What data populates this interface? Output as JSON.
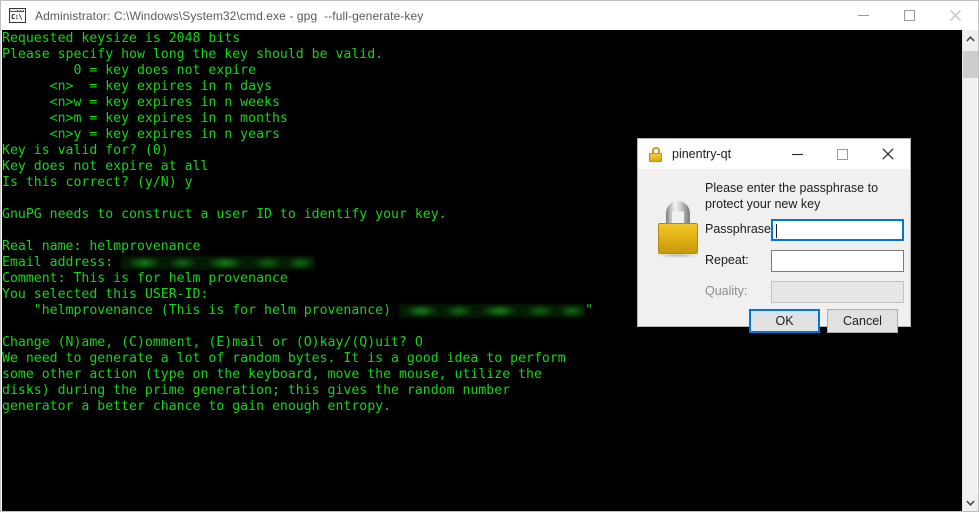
{
  "window": {
    "title": "Administrator: C:\\Windows\\System32\\cmd.exe - gpg  --full-generate-key",
    "icon": "cmd-icon",
    "prompt_glyph": "C:\\",
    "controls": {
      "minimize": "minimize-button",
      "maximize": "maximize-button",
      "close": "close-button"
    }
  },
  "console": {
    "foreground_color": "#13d713",
    "background_color": "#000000",
    "lines": [
      {
        "text": "Requested keysize is 2048 bits"
      },
      {
        "text": "Please specify how long the key should be valid."
      },
      {
        "text": "         0 = key does not expire"
      },
      {
        "text": "      <n>  = key expires in n days"
      },
      {
        "text": "      <n>w = key expires in n weeks"
      },
      {
        "text": "      <n>m = key expires in n months"
      },
      {
        "text": "      <n>y = key expires in n years"
      },
      {
        "text": "Key is valid for? (0)"
      },
      {
        "text": "Key does not expire at all"
      },
      {
        "text": "Is this correct? (y/N) y"
      },
      {
        "text": ""
      },
      {
        "text": "GnuPG needs to construct a user ID to identify your key."
      },
      {
        "text": ""
      },
      {
        "text": "Real name: helmprovenance"
      },
      {
        "text": "Email address: ",
        "redacted": "email-line"
      },
      {
        "text": "Comment: This is for helm provenance"
      },
      {
        "text": "You selected this USER-ID:"
      },
      {
        "text": "    \"helmprovenance (This is for helm provenance) ",
        "redacted": "userid-line",
        "suffix": "\""
      },
      {
        "text": ""
      },
      {
        "text": "Change (N)ame, (C)omment, (E)mail or (O)kay/(Q)uit? O"
      },
      {
        "text": "We need to generate a lot of random bytes. It is a good idea to perform"
      },
      {
        "text": "some other action (type on the keyboard, move the mouse, utilize the"
      },
      {
        "text": "disks) during the prime generation; this gives the random number"
      },
      {
        "text": "generator a better chance to gain enough entropy."
      }
    ]
  },
  "scrollbar": {
    "up_arrow": "scroll-up-arrow",
    "down_arrow": "scroll-down-arrow",
    "thumb": "scroll-thumb"
  },
  "dialog": {
    "title": "pinentry-qt",
    "icon": "padlock-icon",
    "controls": {
      "minimize": "minimize-button",
      "maximize": "maximize-button",
      "close": "close-button"
    },
    "prompt": "Please enter the passphrase to protect your new key",
    "fields": [
      {
        "label": "Passphrase:",
        "value": "",
        "state": "focused"
      },
      {
        "label": "Repeat:",
        "value": "",
        "state": "normal"
      },
      {
        "label": "Quality:",
        "value": "",
        "state": "disabled"
      }
    ],
    "buttons": {
      "ok": "OK",
      "cancel": "Cancel"
    },
    "accent_color": "#0078d7"
  }
}
